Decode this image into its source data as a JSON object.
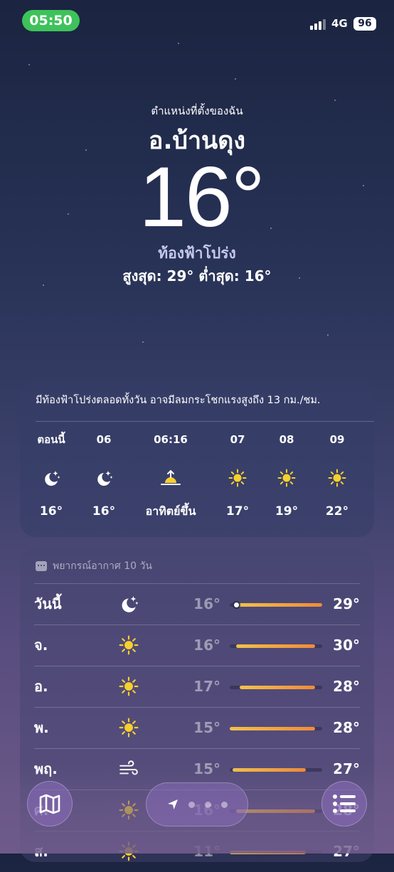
{
  "status_bar": {
    "time": "05:50",
    "network": "4G",
    "battery": "96"
  },
  "header": {
    "location_label": "ตำแหน่งที่ตั้งของฉัน",
    "city": "อ.บ้านดุง",
    "temperature": "16°",
    "condition": "ท้องฟ้าโปร่ง",
    "hi_lo": "สูงสุด: 29°  ต่ำสุด: 16°"
  },
  "hourly": {
    "summary": "มีท้องฟ้าโปร่งตลอดทั้งวัน อาจมีลมกระโชกแรงสูงถึง 13 กม./ชม.",
    "items": [
      {
        "label": "ตอนนี้",
        "icon": "moon-stars-icon",
        "temp": "16°"
      },
      {
        "label": "06",
        "icon": "moon-stars-icon",
        "temp": "16°"
      },
      {
        "label": "06:16",
        "icon": "sunrise-icon",
        "temp": "อาทิตย์ขึ้น"
      },
      {
        "label": "07",
        "icon": "sun-icon",
        "temp": "17°"
      },
      {
        "label": "08",
        "icon": "sun-icon",
        "temp": "19°"
      },
      {
        "label": "09",
        "icon": "sun-icon",
        "temp": "22°"
      }
    ]
  },
  "daily": {
    "title": "พยากรณ์อากาศ 10 วัน",
    "days": [
      {
        "name": "วันนี้",
        "icon": "moon-stars-icon",
        "low": "16°",
        "high": "29°",
        "range_start": 0.07,
        "range_end": 1.0,
        "current": 0.07
      },
      {
        "name": "จ.",
        "icon": "sun-icon",
        "low": "16°",
        "high": "30°",
        "range_start": 0.07,
        "range_end": 0.92
      },
      {
        "name": "อ.",
        "icon": "sun-icon",
        "low": "17°",
        "high": "28°",
        "range_start": 0.11,
        "range_end": 0.92
      },
      {
        "name": "พ.",
        "icon": "sun-icon",
        "low": "15°",
        "high": "28°",
        "range_start": 0.0,
        "range_end": 0.92
      },
      {
        "name": "พฤ.",
        "icon": "wind-icon",
        "low": "15°",
        "high": "27°",
        "range_start": 0.03,
        "range_end": 0.82
      },
      {
        "name": "ศ.",
        "icon": "sun-icon",
        "low": "16°",
        "high": "28°",
        "range_start": 0.07,
        "range_end": 0.92
      },
      {
        "name": "ส.",
        "icon": "sun-icon",
        "low": "11°",
        "high": "27°",
        "range_start": 0.0,
        "range_end": 0.82
      }
    ]
  },
  "colors": {
    "range_warm": "#f0c24a",
    "range_hot": "#f08a3a",
    "sun": "#f7cf2f",
    "now_pill": "#3ec25b"
  },
  "nav": {
    "map_icon": "map-icon",
    "location_icon": "location-arrow-icon",
    "list_icon": "list-icon"
  }
}
